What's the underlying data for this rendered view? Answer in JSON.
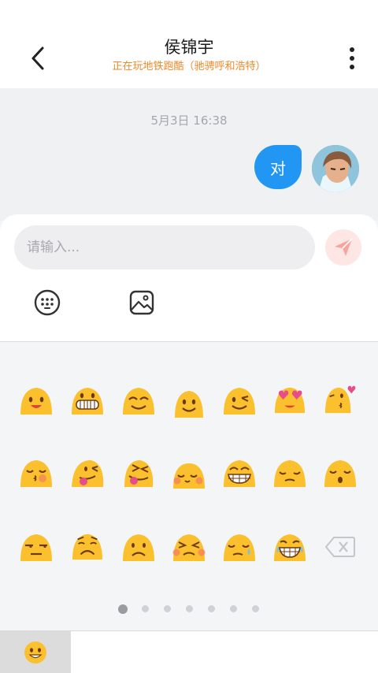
{
  "header": {
    "title": "侯锦宇",
    "subtitle": "正在玩地铁跑酷（驰骋呼和浩特）",
    "back_icon": "chevron-left-icon",
    "more_icon": "more-vertical-icon"
  },
  "chat": {
    "timestamp": "5月3日 16:38",
    "messages": [
      {
        "text": "对",
        "sender": "self"
      }
    ]
  },
  "input": {
    "placeholder": "请输入...",
    "send_icon": "send-icon",
    "tools": [
      "keyboard-grid-icon",
      "image-icon"
    ]
  },
  "emoji_panel": {
    "rows": [
      [
        "smile",
        "grin",
        "happy-closed-eyes",
        "slight-smile",
        "wink",
        "heart-eyes",
        "blow-kiss"
      ],
      [
        "kissing-closed-eyes",
        "tongue-wink",
        "tongue-squint",
        "blush",
        "beaming",
        "pensive",
        "kissing"
      ],
      [
        "unamused",
        "worried",
        "frowning",
        "persevere",
        "disappointed-relieved",
        "joy",
        "delete"
      ]
    ],
    "pages": 7,
    "active_page": 1
  },
  "bottom_bar": {
    "tabs": [
      "emoji-smile-icon"
    ]
  },
  "colors": {
    "accent": "#2196f3",
    "subtitle": "#f0892a",
    "emoji_yellow": "#fbc02d"
  }
}
